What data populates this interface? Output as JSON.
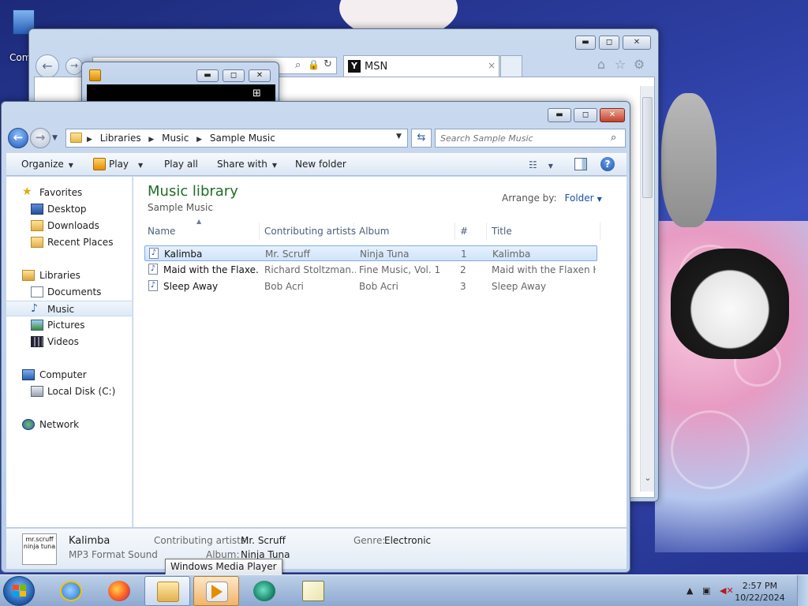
{
  "desktop": {
    "icon_label": "Com"
  },
  "ie": {
    "tab_title": "MSN",
    "tab_logo": "Y",
    "tab_close": "×",
    "icons": [
      "home-icon",
      "star-icon",
      "gear-icon"
    ]
  },
  "explorer": {
    "breadcrumb": [
      "Libraries",
      "Music",
      "Sample Music"
    ],
    "search_placeholder": "Search Sample Music",
    "toolbar": {
      "organize": "Organize",
      "play": "Play",
      "play_all": "Play all",
      "share_with": "Share with",
      "new_folder": "New folder"
    },
    "nav": {
      "favorites": "Favorites",
      "desktop": "Desktop",
      "downloads": "Downloads",
      "recent_places": "Recent Places",
      "libraries": "Libraries",
      "documents": "Documents",
      "music": "Music",
      "pictures": "Pictures",
      "videos": "Videos",
      "computer": "Computer",
      "local_disk": "Local Disk (C:)",
      "network": "Network"
    },
    "library": {
      "title": "Music library",
      "subtitle": "Sample Music",
      "arrange_label": "Arrange by:",
      "arrange_value": "Folder"
    },
    "columns": {
      "name": "Name",
      "artists": "Contributing artists",
      "album": "Album",
      "number": "#",
      "title": "Title"
    },
    "rows": [
      {
        "name": "Kalimba",
        "artist": "Mr. Scruff",
        "album": "Ninja Tuna",
        "num": "1",
        "title": "Kalimba"
      },
      {
        "name": "Maid with the Flaxe...",
        "artist": "Richard Stoltzman...",
        "album": "Fine Music, Vol. 1",
        "num": "2",
        "title": "Maid with the Flaxen H..."
      },
      {
        "name": "Sleep Away",
        "artist": "Bob Acri",
        "album": "Bob Acri",
        "num": "3",
        "title": "Sleep Away"
      }
    ],
    "details": {
      "album_art_text": "mr.scruff ninja tuna",
      "file_name": "Kalimba",
      "file_type": "MP3 Format Sound",
      "artists_label": "Contributing artists:",
      "artists_value": "Mr. Scruff",
      "album_label": "Album:",
      "album_value": "Ninja Tuna",
      "genre_label": "Genre:",
      "genre_value": "Electronic"
    }
  },
  "tooltip": "Windows Media Player",
  "taskbar": {
    "time": "2:57 PM",
    "date": "10/22/2024"
  }
}
